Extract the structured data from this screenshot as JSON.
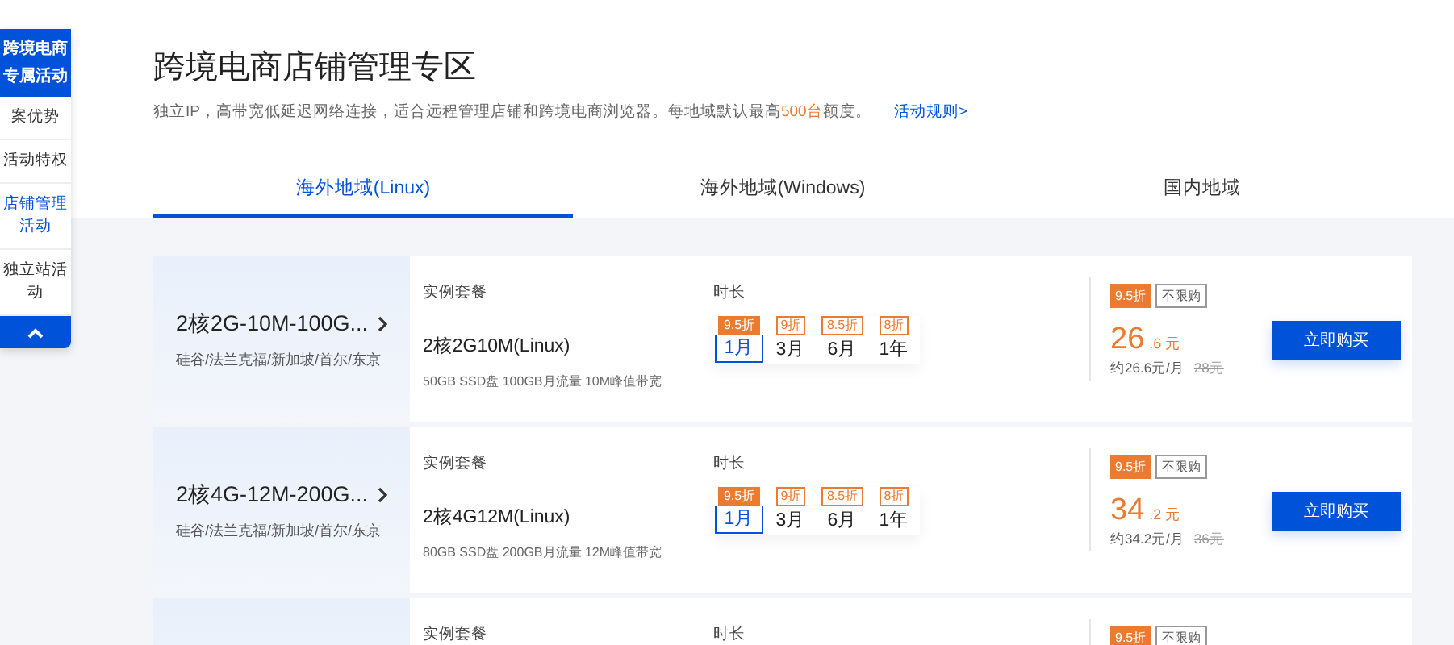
{
  "sidebar": {
    "header": "跨境电商专属活动",
    "items": [
      {
        "label": "案优势",
        "selected": false
      },
      {
        "label": "活动特权",
        "selected": false
      },
      {
        "label": "店铺管理活动",
        "selected": true
      },
      {
        "label": "独立站活动",
        "selected": false
      }
    ]
  },
  "page": {
    "title": "跨境电商店铺管理专区",
    "subtitle": "独立IP，高带宽低延迟网络连接，适合远程管理店铺和跨境电商浏览器。每地域默认最高**500台**额度。",
    "rules_link": "活动规则>"
  },
  "tabs": [
    {
      "label": "海外地域(Linux)",
      "selected": true
    },
    {
      "label": "海外地域(Windows)",
      "selected": false
    },
    {
      "label": "国内地域",
      "selected": false
    }
  ],
  "products": [
    {
      "name": "2核2G-10M-100G...",
      "regions": "硅谷/法兰克福/新加坡/首尔/东京",
      "plan_label": "实例套餐",
      "plan": "2核2G10M(Linux)",
      "spec": "50GB SSD盘 100GB月流量 10M峰值带宽",
      "duration_label": "时长",
      "durations": [
        {
          "label": "1月",
          "discount": "9.5折",
          "selected": true
        },
        {
          "label": "3月",
          "discount": "9折",
          "selected": false
        },
        {
          "label": "6月",
          "discount": "8.5折",
          "selected": false
        },
        {
          "label": "1年",
          "discount": "8折",
          "selected": false
        }
      ],
      "discount_tag": "9.5折",
      "limit_tag": "不限购",
      "price_int": "26",
      "price_dec": ".6 元",
      "monthly": "约26.6元/月",
      "original": "28元",
      "button": "立即购买"
    },
    {
      "name": "2核4G-12M-200G...",
      "regions": "硅谷/法兰克福/新加坡/首尔/东京",
      "plan_label": "实例套餐",
      "plan": "2核4G12M(Linux)",
      "spec": "80GB SSD盘 200GB月流量 12M峰值带宽",
      "duration_label": "时长",
      "durations": [
        {
          "label": "1月",
          "discount": "9.5折",
          "selected": true
        },
        {
          "label": "3月",
          "discount": "9折",
          "selected": false
        },
        {
          "label": "6月",
          "discount": "8.5折",
          "selected": false
        },
        {
          "label": "1年",
          "discount": "8折",
          "selected": false
        }
      ],
      "discount_tag": "9.5折",
      "limit_tag": "不限购",
      "price_int": "34",
      "price_dec": ".2 元",
      "monthly": "约34.2元/月",
      "original": "36元",
      "button": "立即购买"
    },
    {
      "plan_label": "实例套餐",
      "duration_label": "时长",
      "discount_tag": "9.5折",
      "limit_tag": "不限购"
    }
  ]
}
